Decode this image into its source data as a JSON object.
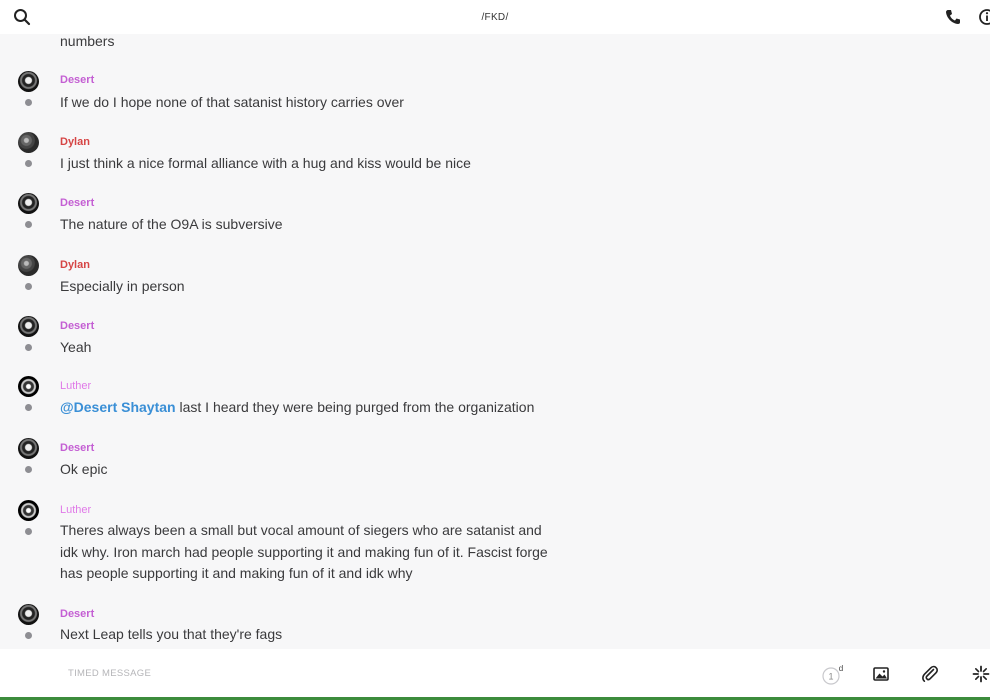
{
  "header": {
    "title": "/FKD/"
  },
  "messages": [
    {
      "sender": "",
      "text": "numbers"
    },
    {
      "sender": "Desert",
      "text": "If we do I hope none of that satanist history carries over"
    },
    {
      "sender": "Dylan",
      "text": "I just think a nice formal alliance with a hug and kiss would be nice"
    },
    {
      "sender": "Desert",
      "text": "The nature of the O9A is subversive"
    },
    {
      "sender": "Dylan",
      "text": "Especially in person"
    },
    {
      "sender": "Desert",
      "text": "Yeah"
    },
    {
      "sender": "Luther",
      "mention": "@Desert Shaytan",
      "text": " last I heard they were being purged from the organization"
    },
    {
      "sender": "Desert",
      "text": "Ok epic"
    },
    {
      "sender": "Luther",
      "text": "Theres always been a small but vocal amount of siegers who are satanist and idk why. Iron march had people supporting it and making fun of it. Fascist forge has people supporting it and making fun of it and idk why"
    },
    {
      "sender": "Desert",
      "text": "Next Leap tells you that they're fags"
    }
  ],
  "composer": {
    "placeholder": "TIMED MESSAGE",
    "timer_value": "1",
    "timer_unit": "d"
  },
  "icons": {
    "search": "search-icon",
    "phone": "phone-icon",
    "info": "info-icon",
    "image": "image-icon",
    "attach": "paperclip-icon",
    "sparkle": "sparkle-icon",
    "timer": "timer-icon"
  },
  "colors": {
    "desert": "#c45fd3",
    "dylan": "#d64545",
    "luther": "#e07ae8",
    "mention": "#3a8fd6"
  }
}
